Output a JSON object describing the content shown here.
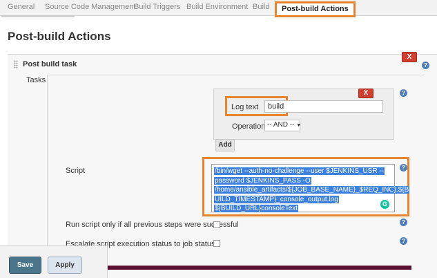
{
  "tabs": [
    {
      "label": "General"
    },
    {
      "label": "Source Code Management"
    },
    {
      "label": "Build Triggers"
    },
    {
      "label": "Build Environment"
    },
    {
      "label": "Build"
    },
    {
      "label": "Post-build Actions",
      "active": true
    }
  ],
  "page_title": "Post-build Actions",
  "section": {
    "title": "Post build task",
    "delete_label": "X",
    "tasks_label": "Tasks"
  },
  "log_text": {
    "label": "Log text",
    "value": "build",
    "delete_label": "X",
    "operation_label": "Operation",
    "operation_value": "-- AND --",
    "add_label": "Add"
  },
  "script": {
    "label": "Script",
    "lines": [
      "/bin/wget --auth-no-challenge --user $JENKINS_USR --",
      "password $JENKINS_PASS -O",
      "/home/ansible_artifacts/${JOB_BASE_NAME}_$REQ_INC}.${B",
      "UILD_TIMESTAMP}_console_output.log",
      "${BUILD_URL}consoleText"
    ]
  },
  "options": {
    "run_if_success_label": "Run script only if all previous steps were successful",
    "escalate_label": "Escalate script execution status to job status"
  },
  "help_symbol": "?",
  "grammarly_symbol": "G",
  "buttons": {
    "save": "Save",
    "apply": "Apply"
  },
  "colors": {
    "highlight": "#e8832e",
    "delete": "#d33f2e",
    "selection": "#3d80dd",
    "save": "#4b758b"
  },
  "icons": [
    "help-icon",
    "drag-handle-icon",
    "grammarly-icon"
  ]
}
